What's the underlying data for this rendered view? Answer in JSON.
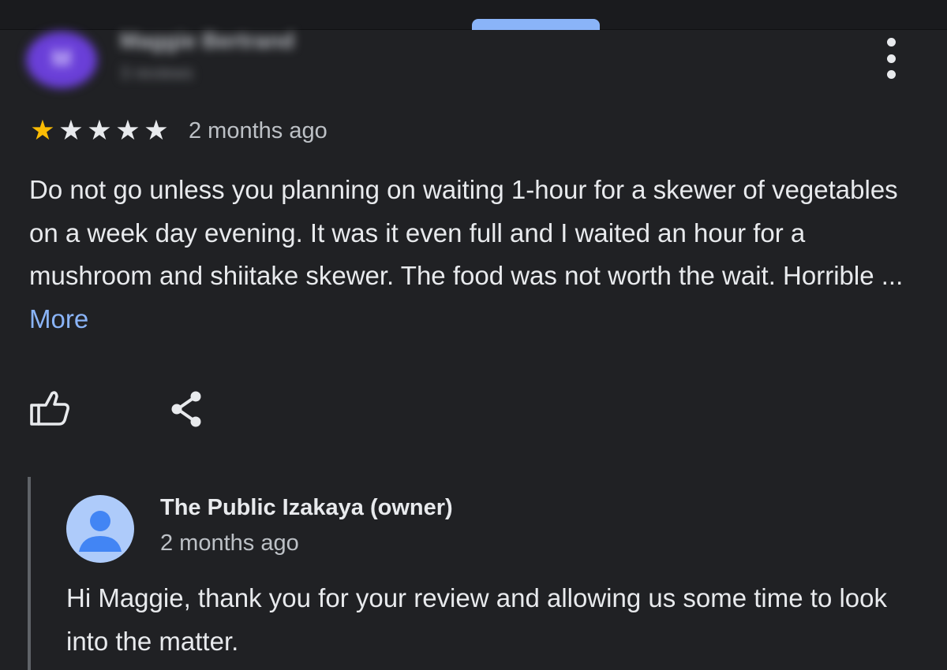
{
  "review": {
    "avatar_initial": "M",
    "reviewer_name": "Maggie Bertrand",
    "reviewer_meta": "3 reviews",
    "rating": 1,
    "max_rating": 5,
    "date": "2 months ago",
    "text": "Do not go unless you planning on waiting 1-hour for a skewer of vegetables on a week day evening. It was it even full and I waited an hour for a mushroom and shiitake skewer. The food was not worth the wait. Horrible",
    "ellipsis": " ... ",
    "more_label": "More"
  },
  "owner_response": {
    "name": "The Public Izakaya (owner)",
    "date": "2 months ago",
    "text": "Hi Maggie, thank you for your review and allowing us some time to look into the matter."
  },
  "icons": {
    "menu": "more-vert-icon",
    "like": "thumb-up-icon",
    "share": "share-icon",
    "owner_avatar": "person-icon",
    "star": "star-icon"
  },
  "colors": {
    "background": "#202124",
    "star_filled": "#fbbc04",
    "star_empty": "#e8eaed",
    "link": "#8ab4f8",
    "owner_avatar_bg": "#aecbfa",
    "owner_avatar_fg": "#4285f4"
  }
}
